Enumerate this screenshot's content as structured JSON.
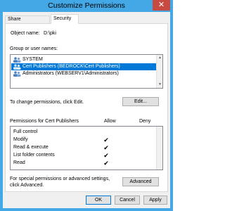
{
  "window": {
    "title": "Customize Permissions",
    "close_glyph": "✕"
  },
  "tabs": [
    {
      "label": "Share Permissions",
      "active": false
    },
    {
      "label": "Security",
      "active": true
    }
  ],
  "object": {
    "label": "Object name:",
    "value": "D:\\pki"
  },
  "groups": {
    "label": "Group or user names:",
    "items": [
      {
        "label": "SYSTEM",
        "icon": "user-group-icon",
        "selected": false
      },
      {
        "label": "Cert Publishers (BEDROCK\\Cert Publishers)",
        "icon": "user-group-icon",
        "selected": true
      },
      {
        "label": "Administrators (WEBSERV1\\Administrators)",
        "icon": "user-group-icon",
        "selected": false
      }
    ]
  },
  "change": {
    "label": "To change permissions, click Edit.",
    "button": "Edit..."
  },
  "permissions": {
    "header": "Permissions for Cert Publishers",
    "allow_header": "Allow",
    "deny_header": "Deny",
    "check_glyph": "✔",
    "rows": [
      {
        "name": "Full control",
        "allow": false,
        "deny": false
      },
      {
        "name": "Modify",
        "allow": true,
        "deny": false
      },
      {
        "name": "Read & execute",
        "allow": true,
        "deny": false
      },
      {
        "name": "List folder contents",
        "allow": true,
        "deny": false
      },
      {
        "name": "Read",
        "allow": true,
        "deny": false
      }
    ]
  },
  "special": {
    "label": "For special permissions or advanced settings, click Advanced.",
    "button": "Advanced"
  },
  "footer": {
    "ok": "OK",
    "cancel": "Cancel",
    "apply": "Apply"
  },
  "colors": {
    "title_bar": "#44a8e6",
    "selection": "#0078d7",
    "close_button": "#c74b42"
  }
}
